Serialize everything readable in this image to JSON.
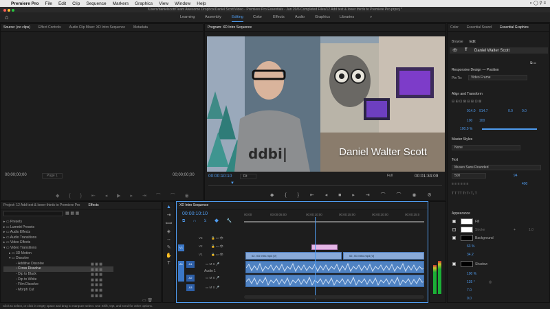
{
  "menubar": {
    "app": "Premiere Pro",
    "items": [
      "File",
      "Edit",
      "Clip",
      "Sequence",
      "Markers",
      "Graphics",
      "View",
      "Window",
      "Help"
    ]
  },
  "titlebar": {
    "title": "/Users/danielscott/Team Awesome Dropbox/Daniel Scott/Video - Premiere Pro Essentials - Jan 20/6 Completed Files/12 Add text & lower thirds to Premiere Pro.prproj *"
  },
  "workspaces": {
    "items": [
      "Learning",
      "Assembly",
      "Editing",
      "Color",
      "Effects",
      "Audio",
      "Graphics",
      "Libraries"
    ],
    "active": "Editing"
  },
  "source": {
    "tabs": [
      "Source: (no clips)",
      "Effect Controls",
      "Audio Clip Mixer: XD Intro Sequence",
      "Metadata"
    ],
    "timecode_left": "00;00;00;00",
    "page": "Page 1",
    "timecode_right": "00;00;00;00"
  },
  "program": {
    "tab": "Program: XD Intro Sequence",
    "lower_third": "Daniel Walter Scott",
    "timecode": "00:00:10:10",
    "fit": "Fit",
    "resolution": "Full",
    "duration": "00:01:34:09"
  },
  "essential_graphics": {
    "tabs": [
      "Color",
      "Essential Sound",
      "Essential Graphics"
    ],
    "subtabs": [
      "Browse",
      "Edit"
    ],
    "layer": "Daniel Walter Scott",
    "responsive_design": "Responsive Design — Position",
    "pin_to_label": "Pin To:",
    "pin_to_value": "Video Frame",
    "align_transform": "Align and Transform",
    "pos_x": "914.0",
    "pos_y": "914.7",
    "rotation": "0.0",
    "anchor": "0.0",
    "scale": "100",
    "scale2": "100",
    "opacity": "100.0 %",
    "master_styles": "Master Styles",
    "master_value": "None",
    "text_header": "Text",
    "font": "Museo Sans Rounded",
    "weight": "500",
    "size": "94",
    "tracking": "400",
    "appearance": "Appearance",
    "fill": "Fill",
    "stroke": "Stroke",
    "stroke_val": "1.0",
    "background": "Background",
    "bg_opacity": "63 %",
    "bg_size": "34.2",
    "shadow": "Shadow",
    "shadow_opacity": "100 %",
    "shadow_angle": "135 °",
    "shadow_dist": "7.0",
    "shadow_blur": "0.0",
    "shadow_size": "40"
  },
  "project": {
    "tabs": [
      "Project: 12 Add text & lower thirds to Premiere Pro",
      "Effects"
    ],
    "tree": [
      "Presets",
      "Lumetri Presets",
      "Audio Effects",
      "Audio Transitions",
      "Video Effects",
      "Video Transitions",
      "3D Motion",
      "Dissolve",
      "Additive Dissolve",
      "Cross Dissolve",
      "Dip to Black",
      "Dip to White",
      "Film Dissolve",
      "Morph Cut"
    ]
  },
  "timeline": {
    "tab": "XD Intro Sequence",
    "timecode": "00:00:10:10",
    "ruler": [
      "00:00",
      "00:00:05:00",
      "00:00:10:00",
      "00:00:15:00",
      "00:00:20:00",
      "00:00:25:0"
    ],
    "tracks": [
      "V3",
      "V2",
      "V1",
      "A1",
      "A2",
      "A3"
    ],
    "audio_label": "Audio 1",
    "clip_left": "02. XD Intro.mp4 [V]",
    "clip_right": "02. XD Intro.mp4 [V]"
  },
  "status": {
    "text": "Click to select, or click in empty space and drag to marquee select. Use Shift, Opt, and Cmd for other options."
  }
}
